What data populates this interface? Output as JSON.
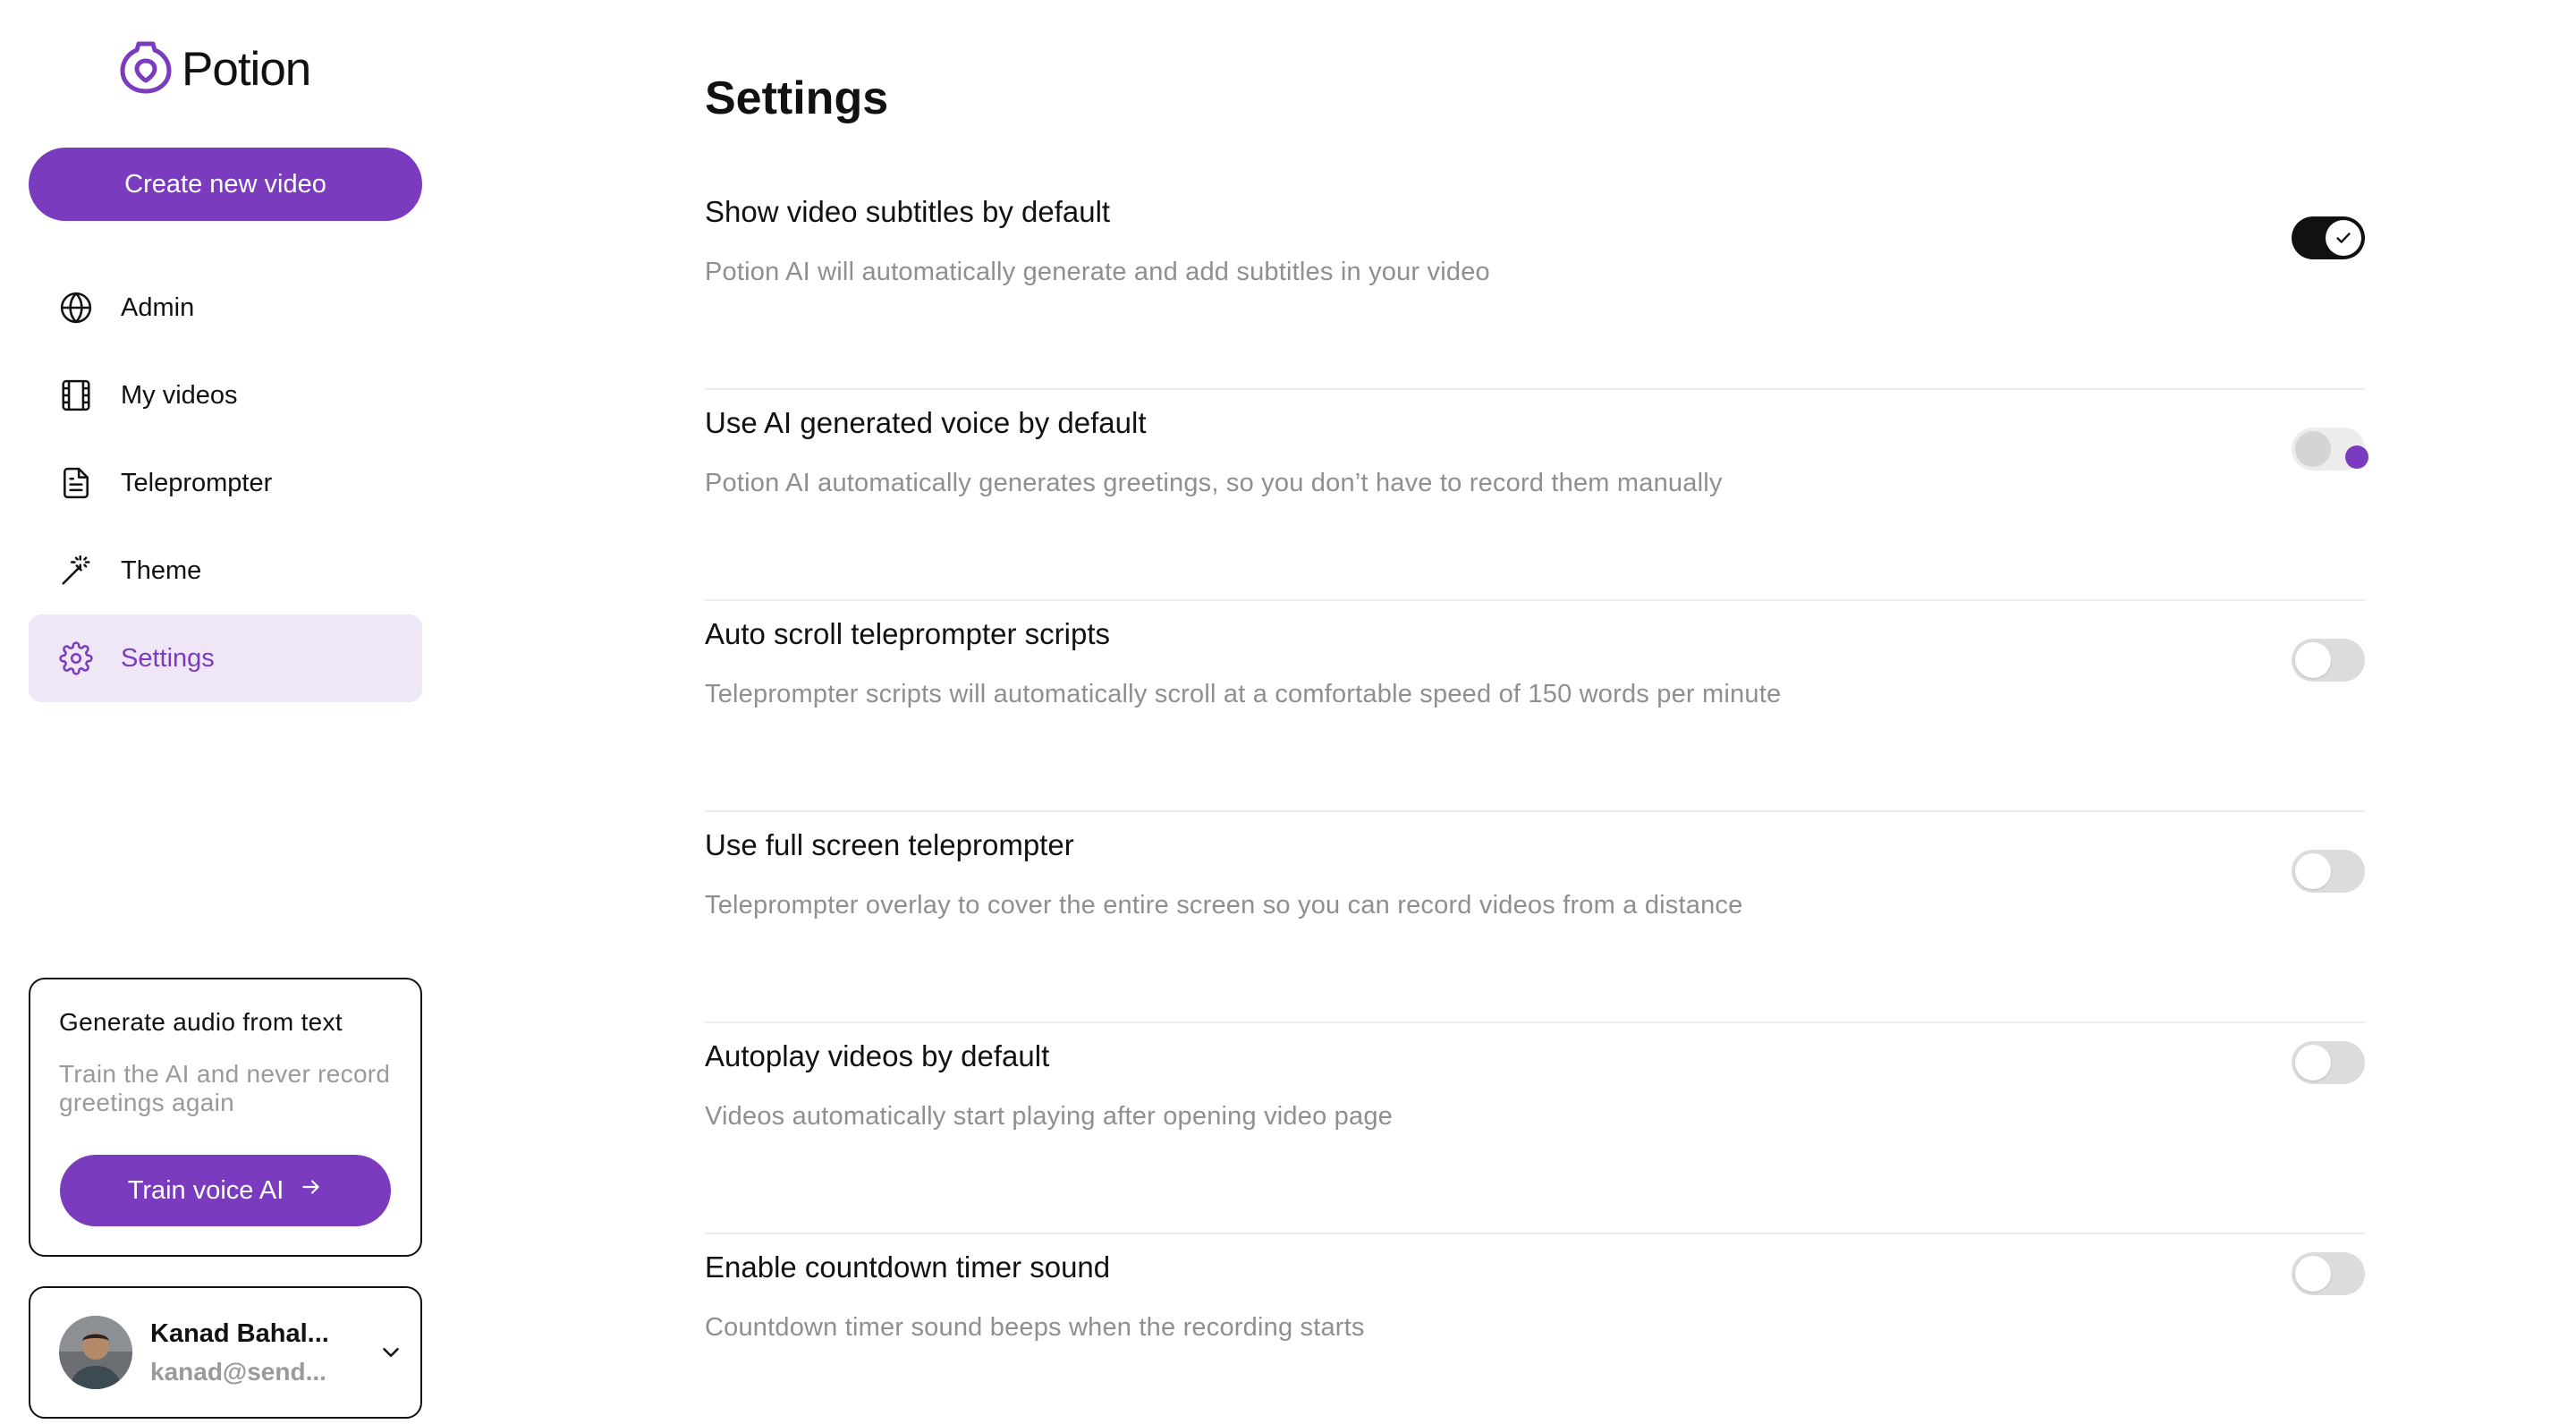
{
  "brand": {
    "name": "Potion",
    "accent": "#7b3bbf"
  },
  "sidebar": {
    "create_label": "Create new video",
    "items": [
      {
        "label": "Admin",
        "icon": "globe-icon"
      },
      {
        "label": "My videos",
        "icon": "film-icon"
      },
      {
        "label": "Teleprompter",
        "icon": "document-icon"
      },
      {
        "label": "Theme",
        "icon": "magic-wand-icon"
      },
      {
        "label": "Settings",
        "icon": "gear-icon",
        "active": true
      }
    ],
    "promo": {
      "title": "Generate audio from text",
      "description": "Train the AI and never record greetings again",
      "button_label": "Train voice AI"
    },
    "user": {
      "name": "Kanad Bahal...",
      "email": "kanad@send..."
    }
  },
  "main": {
    "title": "Settings",
    "settings": [
      {
        "title": "Show video subtitles by default",
        "description": "Potion AI will automatically generate and add subtitles in your video",
        "state": "on"
      },
      {
        "title": "Use AI generated voice by default",
        "description": "Potion AI automatically generates greetings, so you don’t have to record them manually",
        "state": "loading"
      },
      {
        "title": "Auto scroll teleprompter scripts",
        "description": "Teleprompter scripts will automatically scroll at a comfortable speed of 150 words per minute",
        "state": "off"
      },
      {
        "title": "Use full screen teleprompter",
        "description": "Teleprompter overlay to cover the entire screen so you can record videos from a distance",
        "state": "off"
      },
      {
        "title": "Autoplay videos by default",
        "description": "Videos automatically start playing after opening video page",
        "state": "off"
      },
      {
        "title": "Enable countdown timer sound",
        "description": "Countdown timer sound beeps when the recording starts",
        "state": "off"
      }
    ]
  }
}
